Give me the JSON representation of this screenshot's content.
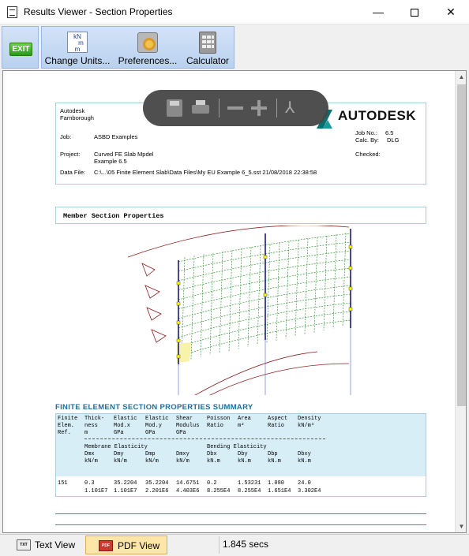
{
  "window": {
    "title": "Results Viewer - Section Properties"
  },
  "toolbar": {
    "exit_label": "EXIT",
    "change_units": {
      "label": "Change Units...",
      "icon_text": [
        "kN",
        "m",
        "m"
      ]
    },
    "preferences": {
      "label": "Preferences..."
    },
    "calculator": {
      "label": "Calculator"
    }
  },
  "header": {
    "company": "Autodesk",
    "location": "Farnborough",
    "job_label": "Job:",
    "job_value": "ASBD Examples",
    "project_label": "Project:",
    "project_value_1": "Curved FE Slab Mpdel",
    "project_value_2": "Example 6.5",
    "datafile_label": "Data File:",
    "datafile_value": "C:\\...\\05 Finite Element Slab\\Data Files\\My EU Example 6_5.sst 21/08/2018 22:38:58",
    "jobno_label": "Job No.:",
    "jobno_value": "6.5",
    "calcby_label": "Calc. By:",
    "calcby_value": "DLG",
    "checked_label": "Checked:",
    "logo_text": "AUTODESK"
  },
  "section": {
    "title": "Member Section Properties"
  },
  "summary": {
    "title": "FINITE ELEMENT SECTION PROPERTIES SUMMARY",
    "head_row1": [
      "Finite",
      "Thick-",
      "Elastic",
      "Elastic",
      "Shear",
      "Poisson",
      "Area",
      "Aspect",
      "Density"
    ],
    "head_row2": [
      "Elem.",
      "ness",
      "Mod.x",
      "Mod.y",
      "Modulus",
      "Ratio",
      "m²",
      "Ratio",
      "kN/m³"
    ],
    "head_row3": [
      "Ref.",
      "m",
      "GPa",
      "GPa",
      "GPa"
    ],
    "membrane_label": "Membrane Elasticity",
    "bending_label": "Bending Elasticity",
    "elast_row1": [
      "Dmx",
      "Dmy",
      "Dmp",
      "Dmxy",
      "Dbx",
      "Dby",
      "Dbp",
      "Dbxy"
    ],
    "elast_row2": [
      "kN/m",
      "kN/m",
      "kN/m",
      "kN/m",
      "kN.m",
      "kN.m",
      "kN.m",
      "kN.m"
    ],
    "data_row1": [
      "151",
      "0.3",
      "35.2204",
      "35.2204",
      "14.6751",
      "0.2",
      "1.53231",
      "1.080",
      "24.0"
    ],
    "data_row2": [
      "1.101E7",
      "1.101E7",
      "2.201E6",
      "4.403E6",
      "8.255E4",
      "8.255E4",
      "1.651E4",
      "3.302E4"
    ]
  },
  "tabs": {
    "text_view": "Text View",
    "pdf_view": "PDF View",
    "text_icon": "TXT",
    "pdf_icon": "PDF"
  },
  "status": {
    "time": "1.845 secs"
  }
}
